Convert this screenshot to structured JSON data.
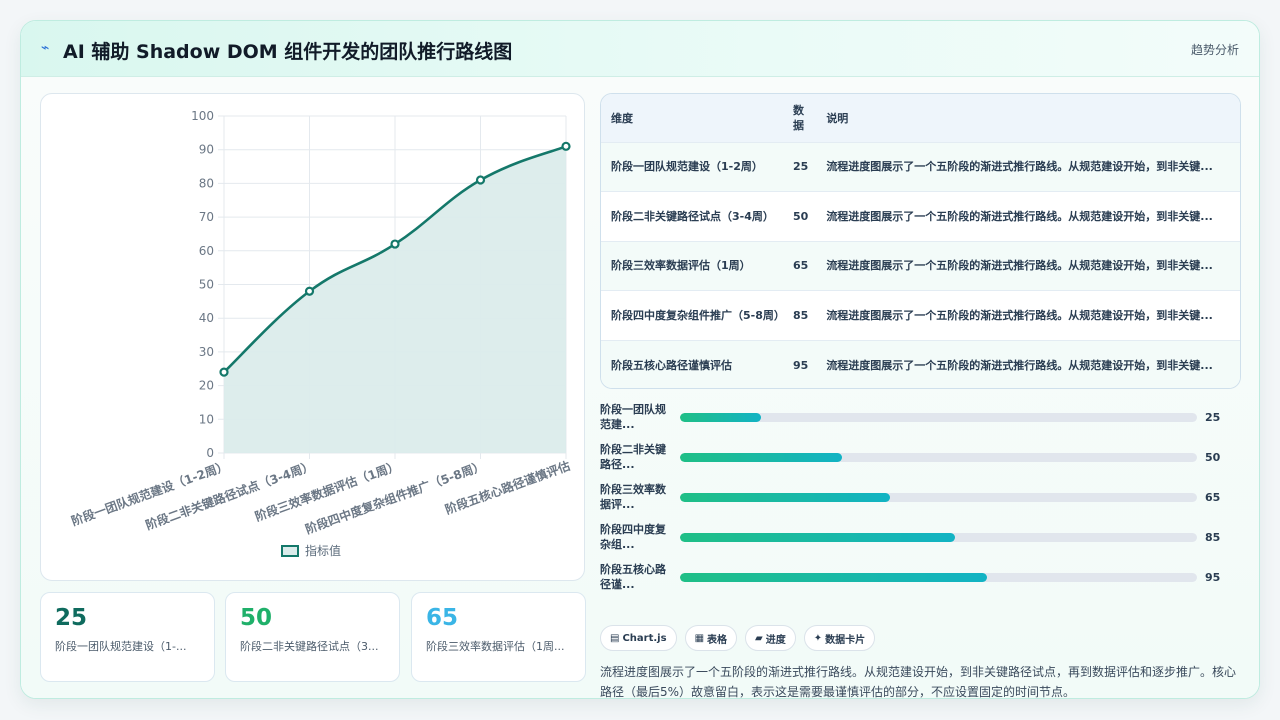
{
  "header": {
    "icon": "bolt-icon",
    "title": "AI 辅助 Shadow DOM 组件开发的团队推行路线图",
    "tag": "趋势分析"
  },
  "colors": {
    "accent": "#14786a",
    "area_fill": "#dbeceb",
    "stat_1": "#0f6b5e",
    "stat_2": "#1fb06a",
    "stat_3": "#3ab5e6"
  },
  "chart_data": {
    "type": "area",
    "categories": [
      "阶段一团队规范建设（1-2周）",
      "阶段二非关键路径试点（3-4周）",
      "阶段三效率数据评估（1周）",
      "阶段四中度复杂组件推广（5-8周）",
      "阶段五核心路径谨慎评估"
    ],
    "series": [
      {
        "name": "指标值",
        "values": [
          24,
          48,
          62,
          81,
          91
        ]
      }
    ],
    "ylim": [
      0,
      100
    ],
    "yticks": [
      0,
      10,
      20,
      30,
      40,
      50,
      60,
      70,
      80,
      90,
      100
    ],
    "grid": true,
    "legend": "bottom-center",
    "smooth": true
  },
  "stats": [
    {
      "value": "25",
      "label": "阶段一团队规范建设（1-..."
    },
    {
      "value": "50",
      "label": "阶段二非关键路径试点（3..."
    },
    {
      "value": "65",
      "label": "阶段三效率数据评估（1周..."
    }
  ],
  "table": {
    "headers": [
      "维度",
      "数据",
      "说明"
    ],
    "rows": [
      {
        "dim": "阶段一团队规范建设（1-2周）",
        "val": "25",
        "note": "流程进度图展示了一个五阶段的渐进式推行路线。从规范建设开始，到非关键..."
      },
      {
        "dim": "阶段二非关键路径试点（3-4周）",
        "val": "50",
        "note": "流程进度图展示了一个五阶段的渐进式推行路线。从规范建设开始，到非关键..."
      },
      {
        "dim": "阶段三效率数据评估（1周）",
        "val": "65",
        "note": "流程进度图展示了一个五阶段的渐进式推行路线。从规范建设开始，到非关键..."
      },
      {
        "dim": "阶段四中度复杂组件推广（5-8周）",
        "val": "85",
        "note": "流程进度图展示了一个五阶段的渐进式推行路线。从规范建设开始，到非关键..."
      },
      {
        "dim": "阶段五核心路径谨慎评估",
        "val": "95",
        "note": "流程进度图展示了一个五阶段的渐进式推行路线。从规范建设开始，到非关键..."
      }
    ]
  },
  "progress": [
    {
      "label": "阶段一团队规范建...",
      "value": "25",
      "fraction": 0.156
    },
    {
      "label": "阶段二非关键路径...",
      "value": "50",
      "fraction": 0.313
    },
    {
      "label": "阶段三效率数据评...",
      "value": "65",
      "fraction": 0.406
    },
    {
      "label": "阶段四中度复杂组...",
      "value": "85",
      "fraction": 0.531
    },
    {
      "label": "阶段五核心路径谨...",
      "value": "95",
      "fraction": 0.594
    }
  ],
  "chips": [
    {
      "icon": "chart-icon",
      "glyph": "▤",
      "label": "Chart.js"
    },
    {
      "icon": "table-icon",
      "glyph": "▦",
      "label": "表格"
    },
    {
      "icon": "progress-icon",
      "glyph": "▰",
      "label": "进度"
    },
    {
      "icon": "card-icon",
      "glyph": "✦",
      "label": "数据卡片"
    }
  ],
  "description": "流程进度图展示了一个五阶段的渐进式推行路线。从规范建设开始，到非关键路径试点，再到数据评估和逐步推广。核心路径（最后5%）故意留白，表示这是需要最谨慎评估的部分，不应设置固定的时间节点。"
}
